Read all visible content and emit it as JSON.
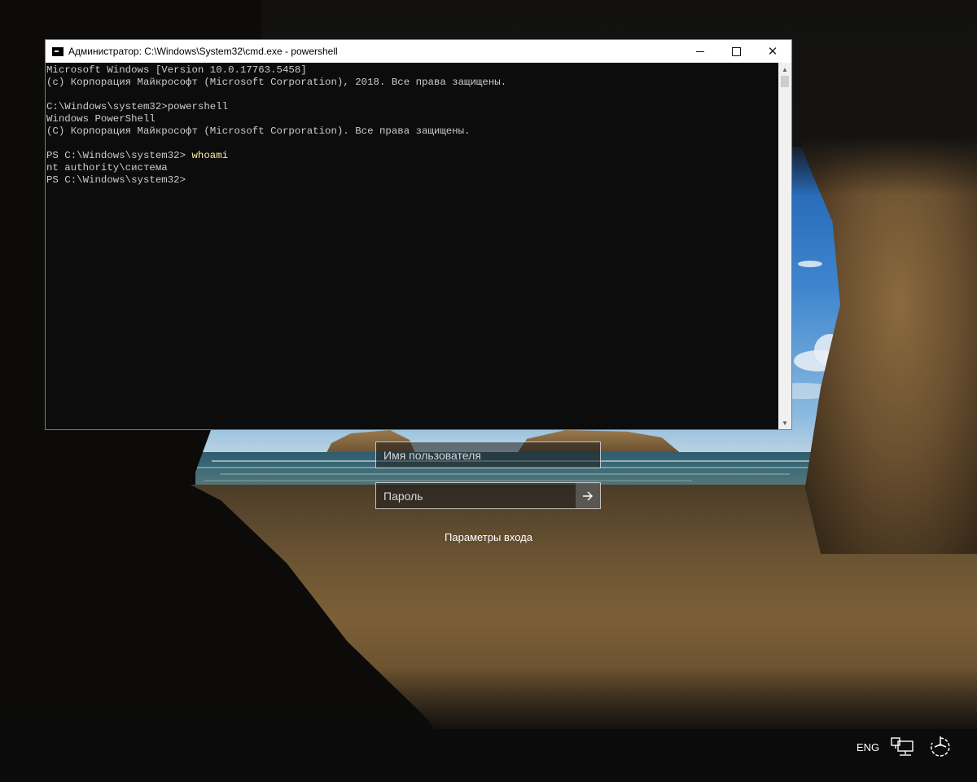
{
  "console": {
    "title": "Администратор: C:\\Windows\\System32\\cmd.exe - powershell",
    "icon": "cmd-icon",
    "lines": [
      {
        "text": "Microsoft Windows [Version 10.0.17763.5458]",
        "type": "output"
      },
      {
        "text": "(c) Корпорация Майкрософт (Microsoft Corporation), 2018. Все права защищены.",
        "type": "output"
      },
      {
        "text": "",
        "type": "output"
      },
      {
        "text": "C:\\Windows\\system32>powershell",
        "type": "output"
      },
      {
        "text": "Windows PowerShell",
        "type": "output"
      },
      {
        "text": "(C) Корпорация Майкрософт (Microsoft Corporation). Все права защищены.",
        "type": "output"
      },
      {
        "text": "",
        "type": "output"
      },
      {
        "prompt": "PS C:\\Windows\\system32> ",
        "command": "whoami",
        "type": "prompt"
      },
      {
        "text": "nt authority\\система",
        "type": "output"
      },
      {
        "prompt": "PS C:\\Windows\\system32>",
        "command": "",
        "type": "prompt"
      }
    ],
    "text_color": "#cccccc",
    "command_color": "#f9f1a5",
    "background": "#0c0c0c"
  },
  "login": {
    "username_placeholder": "Имя пользователя",
    "password_placeholder": "Пароль",
    "submit_icon": "arrow-right-icon",
    "signin_options": "Параметры входа"
  },
  "tray": {
    "language": "ENG",
    "network_icon": "network-icon",
    "power_icon": "accessibility-power-icon"
  }
}
